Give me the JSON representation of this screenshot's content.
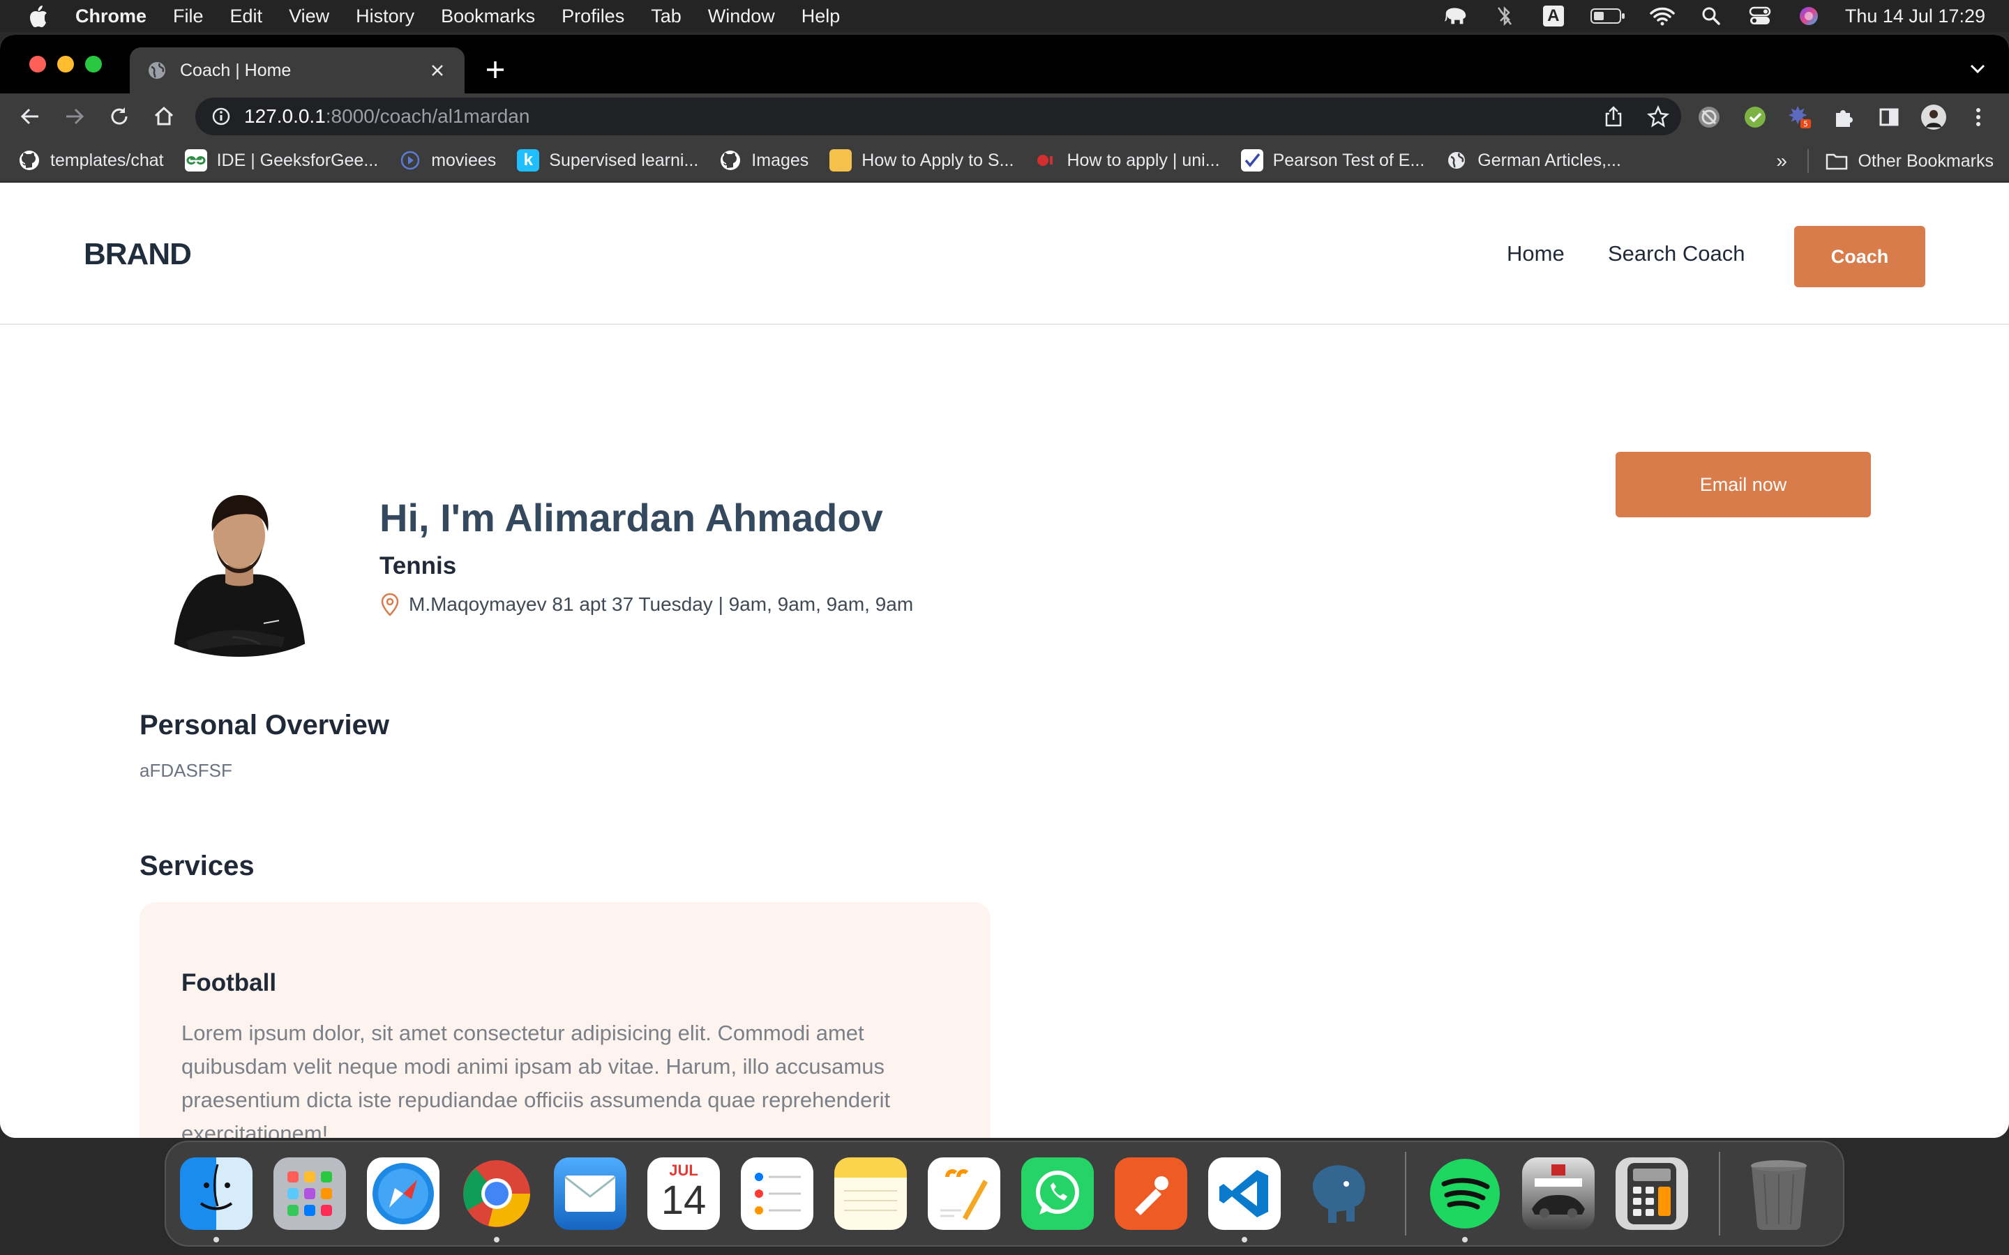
{
  "menubar": {
    "app_name": "Chrome",
    "items": [
      "File",
      "Edit",
      "View",
      "History",
      "Bookmarks",
      "Profiles",
      "Tab",
      "Window",
      "Help"
    ],
    "clock": "Thu 14 Jul  17:29",
    "status_icons": [
      "elephant-icon",
      "bluetooth-off-icon",
      "input-source-a-icon",
      "battery-icon",
      "wifi-icon",
      "spotlight-icon",
      "control-center-icon",
      "siri-icon"
    ]
  },
  "browser": {
    "tab": {
      "title": "Coach | Home"
    },
    "address": {
      "host": "127.0.0.1",
      "path": ":8000/coach/al1mardan"
    },
    "extension_badge": "5",
    "bookmarks": [
      {
        "label": "templates/chat",
        "icon": "github-icon"
      },
      {
        "label": "IDE | GeeksforGee...",
        "icon": "geeksforgeeks-icon"
      },
      {
        "label": "moviees",
        "icon": "play-icon"
      },
      {
        "label": "Supervised learni...",
        "icon": "kaggle-icon"
      },
      {
        "label": "Images",
        "icon": "github-icon"
      },
      {
        "label": "How to Apply to S...",
        "icon": "folder-yellow-icon"
      },
      {
        "label": "How to apply | uni...",
        "icon": "record-icon"
      },
      {
        "label": "Pearson Test of E...",
        "icon": "checkbox-icon"
      },
      {
        "label": "German Articles,...",
        "icon": "globe-icon"
      }
    ],
    "more_label": "»",
    "other_bookmarks": "Other Bookmarks"
  },
  "site": {
    "brand": "BRAND",
    "nav": {
      "home": "Home",
      "search": "Search Coach",
      "coach_button": "Coach"
    },
    "profile": {
      "greeting": "Hi, I'm Alimardan Ahmadov",
      "sport": "Tennis",
      "location": "M.Maqoymayev 81 apt 37 Tuesday | 9am, 9am, 9am, 9am",
      "email_button": "Email now"
    },
    "overview": {
      "title": "Personal Overview",
      "text": "aFDASFSF"
    },
    "services": {
      "title": "Services",
      "items": [
        {
          "title": "Football",
          "description": "Lorem ipsum dolor, sit amet consectetur adipisicing elit. Commodi amet quibusdam velit neque modi animi ipsam ab vitae. Harum, illo accusamus praesentium dicta iste repudiandae officiis assumenda quae reprehenderit exercitationem!"
        }
      ]
    }
  },
  "dock": {
    "calendar_month": "JUL",
    "calendar_day": "14",
    "apps": [
      "finder-icon",
      "launchpad-icon",
      "safari-icon",
      "chrome-icon",
      "mail-icon",
      "calendar-icon",
      "reminders-icon",
      "notes-icon",
      "pages-icon",
      "whatsapp-icon",
      "postman-icon",
      "vscode-icon",
      "pgadmin-icon",
      "spotify-icon",
      "asphalt-icon",
      "calculator-icon",
      "trash-icon"
    ]
  },
  "colors": {
    "accent": "#d97c4c",
    "heading": "#34495e",
    "card_bg": "#fdf3ef"
  }
}
